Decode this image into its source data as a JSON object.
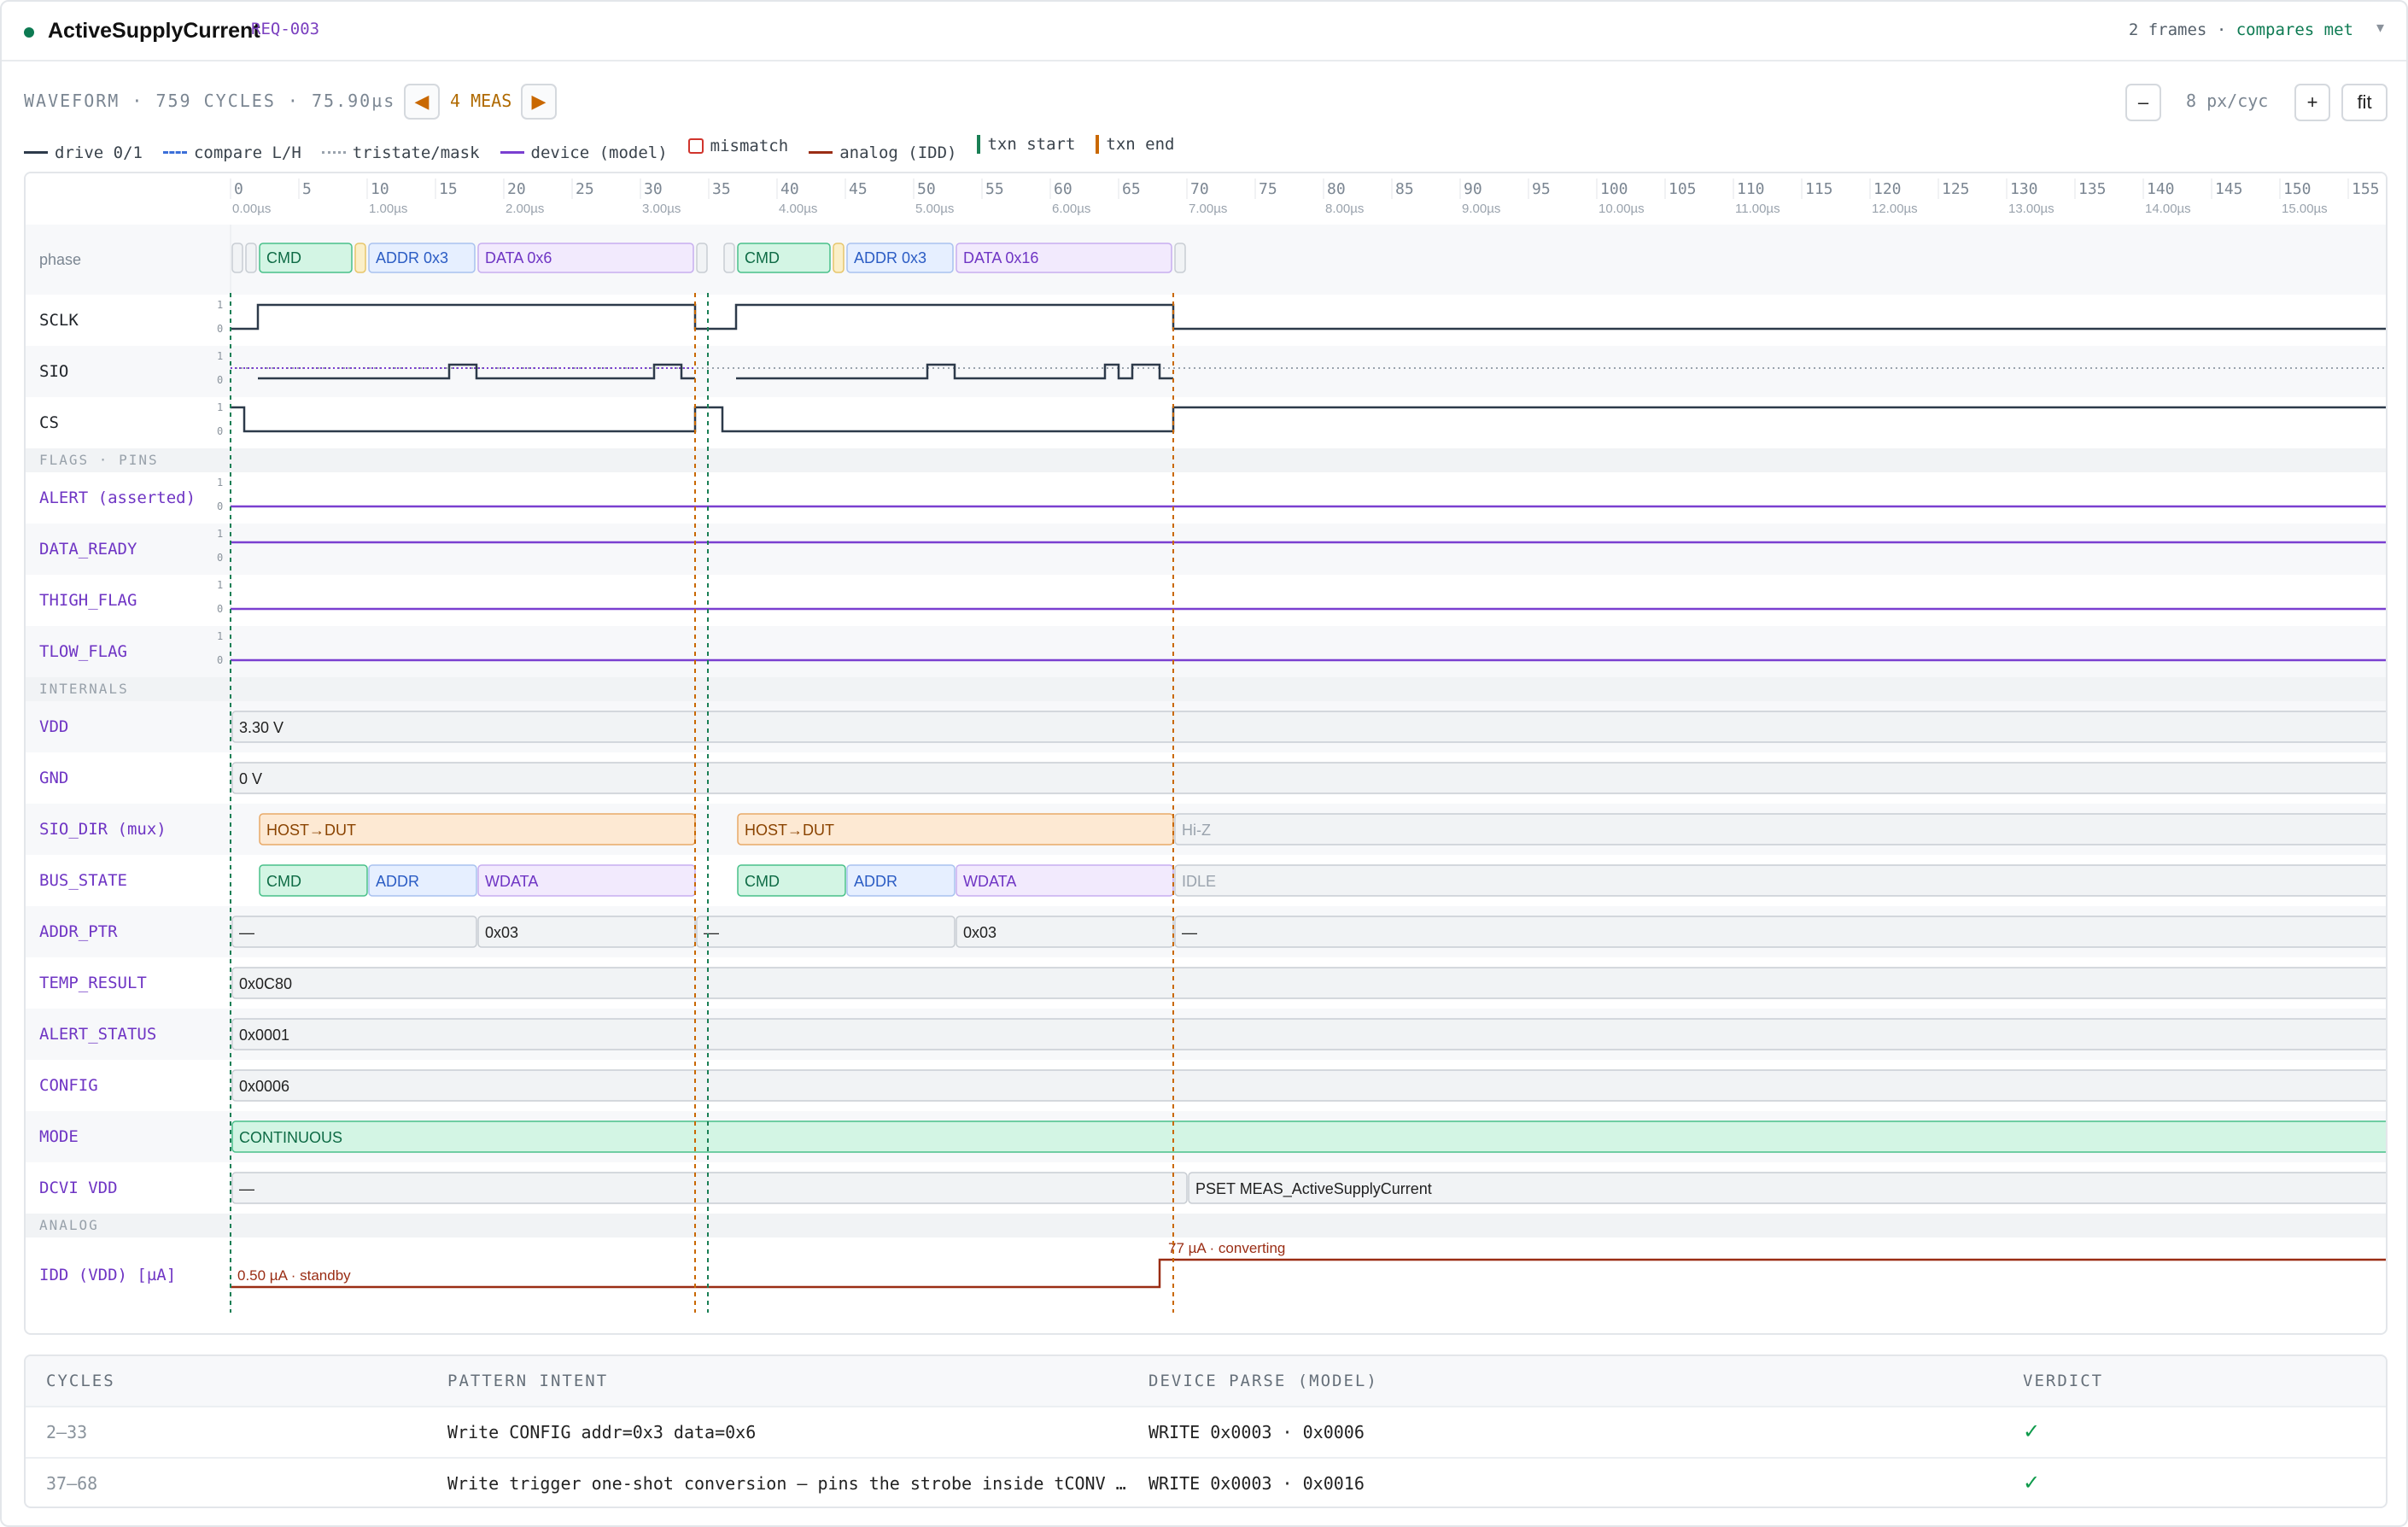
{
  "header": {
    "title": "ActiveSupplyCurrent",
    "req": "REQ-003",
    "frames": "2 frames",
    "sep": "·",
    "compares": "compares met",
    "caret": "▾"
  },
  "toolbar": {
    "waveform_info": "WAVEFORM · 759 CYCLES · 75.90µs",
    "prev": "◀",
    "meas_label": "4 MEAS",
    "next": "▶",
    "zoom_out": "–",
    "zoom_level": "8 px/cyc",
    "zoom_in": "+",
    "fit": "fit"
  },
  "legend": [
    {
      "label": "drive 0/1",
      "color": "#2d3a4a",
      "style": "solid"
    },
    {
      "label": "compare L/H",
      "color": "#3b6fd8",
      "style": "dashed"
    },
    {
      "label": "tristate/mask",
      "color": "#9aa3ad",
      "style": "dotted"
    },
    {
      "label": "device (model)",
      "color": "#7a3fd0",
      "style": "solid"
    },
    {
      "label": "mismatch",
      "color": "#d0342c",
      "style": "box"
    },
    {
      "label": "analog (IDD)",
      "color": "#9a2d14",
      "style": "solid"
    },
    {
      "label": "txn start",
      "color": "#1a7f55",
      "style": "bar"
    },
    {
      "label": "txn end",
      "color": "#c96800",
      "style": "bar"
    }
  ],
  "axis": {
    "cycle_ticks": [
      0,
      5,
      10,
      15,
      20,
      25,
      30,
      35,
      40,
      45,
      50,
      55,
      60,
      65,
      70,
      75,
      80,
      85,
      90,
      95,
      100,
      105,
      110,
      115,
      120,
      125,
      130,
      135,
      140,
      145,
      150,
      155
    ],
    "time_labels": [
      {
        "cycle": 0,
        "label": "0.00µs"
      },
      {
        "cycle": 10,
        "label": "1.00µs"
      },
      {
        "cycle": 20,
        "label": "2.00µs"
      },
      {
        "cycle": 30,
        "label": "3.00µs"
      },
      {
        "cycle": 40,
        "label": "4.00µs"
      },
      {
        "cycle": 50,
        "label": "5.00µs"
      },
      {
        "cycle": 60,
        "label": "6.00µs"
      },
      {
        "cycle": 70,
        "label": "7.00µs"
      },
      {
        "cycle": 80,
        "label": "8.00µs"
      },
      {
        "cycle": 90,
        "label": "9.00µs"
      },
      {
        "cycle": 100,
        "label": "10.00µs"
      },
      {
        "cycle": 110,
        "label": "11.00µs"
      },
      {
        "cycle": 120,
        "label": "12.00µs"
      },
      {
        "cycle": 130,
        "label": "13.00µs"
      },
      {
        "cycle": 140,
        "label": "14.00µs"
      },
      {
        "cycle": 150,
        "label": "15.00µs"
      }
    ],
    "txn_start_cycles": [
      0,
      35
    ],
    "txn_end_cycles": [
      34,
      69
    ]
  },
  "tracks": [
    {
      "kind": "phase",
      "label": "phase",
      "segments": [
        {
          "start": 0,
          "end": 1,
          "text": "",
          "color": "gray"
        },
        {
          "start": 1,
          "end": 2,
          "text": "",
          "color": "gray"
        },
        {
          "start": 2,
          "end": 9,
          "text": "CMD",
          "color": "green"
        },
        {
          "start": 9,
          "end": 10,
          "text": "",
          "color": "yellow"
        },
        {
          "start": 10,
          "end": 18,
          "text": "ADDR 0x3",
          "color": "blue"
        },
        {
          "start": 18,
          "end": 34,
          "text": "DATA 0x6",
          "color": "purple"
        },
        {
          "start": 34,
          "end": 35,
          "text": "",
          "color": "gray"
        },
        {
          "start": 36,
          "end": 37,
          "text": "",
          "color": "gray"
        },
        {
          "start": 37,
          "end": 44,
          "text": "CMD",
          "color": "green"
        },
        {
          "start": 44,
          "end": 45,
          "text": "",
          "color": "yellow"
        },
        {
          "start": 45,
          "end": 53,
          "text": "ADDR 0x3",
          "color": "blue"
        },
        {
          "start": 53,
          "end": 69,
          "text": "DATA 0x16",
          "color": "purple"
        },
        {
          "start": 69,
          "end": 70,
          "text": "",
          "color": "gray"
        }
      ]
    },
    {
      "kind": "digital",
      "label": "SCLK",
      "color": "drive",
      "init": 0,
      "edges": [
        [
          2,
          1
        ],
        [
          34,
          0
        ],
        [
          37,
          1
        ],
        [
          69,
          0
        ]
      ]
    },
    {
      "kind": "sio",
      "label": "SIO",
      "color": "drive"
    },
    {
      "kind": "digital",
      "label": "CS",
      "color": "drive",
      "init": 1,
      "edges": [
        [
          1,
          0
        ],
        [
          34,
          1
        ],
        [
          36,
          0
        ],
        [
          69,
          1
        ]
      ]
    },
    {
      "kind": "section",
      "label": "FLAGS · PINS"
    },
    {
      "kind": "flag",
      "label": "ALERT (asserted)",
      "level": 0
    },
    {
      "kind": "flag",
      "label": "DATA_READY",
      "level": 1
    },
    {
      "kind": "flag",
      "label": "THIGH_FLAG",
      "level": 0
    },
    {
      "kind": "flag",
      "label": "TLOW_FLAG",
      "level": 0
    },
    {
      "kind": "section",
      "label": "INTERNALS"
    },
    {
      "kind": "bus",
      "label": "VDD",
      "segments": [
        {
          "start": 0,
          "end": 160,
          "text": "3.30 V",
          "color": "gray"
        }
      ]
    },
    {
      "kind": "bus",
      "label": "GND",
      "segments": [
        {
          "start": 0,
          "end": 160,
          "text": "0 V",
          "color": "gray"
        }
      ]
    },
    {
      "kind": "bus",
      "label": "SIO_DIR (mux)",
      "segments": [
        {
          "start": 2,
          "end": 34,
          "text": "HOST→DUT",
          "color": "orange"
        },
        {
          "start": 37,
          "end": 69,
          "text": "HOST→DUT",
          "color": "orange"
        },
        {
          "start": 69,
          "end": 160,
          "text": "Hi-Z",
          "color": "gray"
        }
      ]
    },
    {
      "kind": "bus",
      "label": "BUS_STATE",
      "segments": [
        {
          "start": 2,
          "end": 10,
          "text": "CMD",
          "color": "green"
        },
        {
          "start": 10,
          "end": 18,
          "text": "ADDR",
          "color": "blue"
        },
        {
          "start": 18,
          "end": 34,
          "text": "WDATA",
          "color": "purple"
        },
        {
          "start": 37,
          "end": 45,
          "text": "CMD",
          "color": "green"
        },
        {
          "start": 45,
          "end": 53,
          "text": "ADDR",
          "color": "blue"
        },
        {
          "start": 53,
          "end": 69,
          "text": "WDATA",
          "color": "purple"
        },
        {
          "start": 69,
          "end": 160,
          "text": "IDLE",
          "color": "gray"
        }
      ]
    },
    {
      "kind": "bus",
      "label": "ADDR_PTR",
      "segments": [
        {
          "start": 0,
          "end": 18,
          "text": "—",
          "color": "gray"
        },
        {
          "start": 18,
          "end": 34,
          "text": "0x03",
          "color": "gray"
        },
        {
          "start": 34,
          "end": 53,
          "text": "—",
          "color": "gray"
        },
        {
          "start": 53,
          "end": 69,
          "text": "0x03",
          "color": "gray"
        },
        {
          "start": 69,
          "end": 160,
          "text": "—",
          "color": "gray"
        }
      ]
    },
    {
      "kind": "bus",
      "label": "TEMP_RESULT",
      "segments": [
        {
          "start": 0,
          "end": 160,
          "text": "0x0C80",
          "color": "gray"
        }
      ]
    },
    {
      "kind": "bus",
      "label": "ALERT_STATUS",
      "segments": [
        {
          "start": 0,
          "end": 160,
          "text": "0x0001",
          "color": "gray"
        }
      ]
    },
    {
      "kind": "bus",
      "label": "CONFIG",
      "segments": [
        {
          "start": 0,
          "end": 160,
          "text": "0x0006",
          "color": "gray"
        }
      ]
    },
    {
      "kind": "bus",
      "label": "MODE",
      "segments": [
        {
          "start": 0,
          "end": 160,
          "text": "CONTINUOUS",
          "color": "green"
        }
      ]
    },
    {
      "kind": "bus",
      "label": "DCVI VDD",
      "segments": [
        {
          "start": 0,
          "end": 70,
          "text": "—",
          "color": "gray"
        },
        {
          "start": 70,
          "end": 160,
          "text": "PSET MEAS_ActiveSupplyCurrent",
          "color": "gray"
        }
      ]
    },
    {
      "kind": "section",
      "label": "ANALOG"
    },
    {
      "kind": "analog",
      "label": "IDD (VDD) [µA]",
      "low_label": "0.50 µA · standby",
      "high_label": "77 µA · converting",
      "step_cycle": 68
    }
  ],
  "table": {
    "headers": [
      "CYCLES",
      "PATTERN INTENT",
      "DEVICE PARSE (MODEL)",
      "VERDICT"
    ],
    "rows": [
      {
        "cycles": "2–33",
        "intent": "Write CONFIG addr=0x3 data=0x6",
        "parse": "WRITE 0x0003 · 0x0006",
        "verdict": "✓"
      },
      {
        "cycles": "37–68",
        "intent": "Write trigger one-shot conversion — pins the strobe inside tCONV …",
        "parse": "WRITE 0x0003 · 0x0016",
        "verdict": "✓"
      }
    ]
  }
}
